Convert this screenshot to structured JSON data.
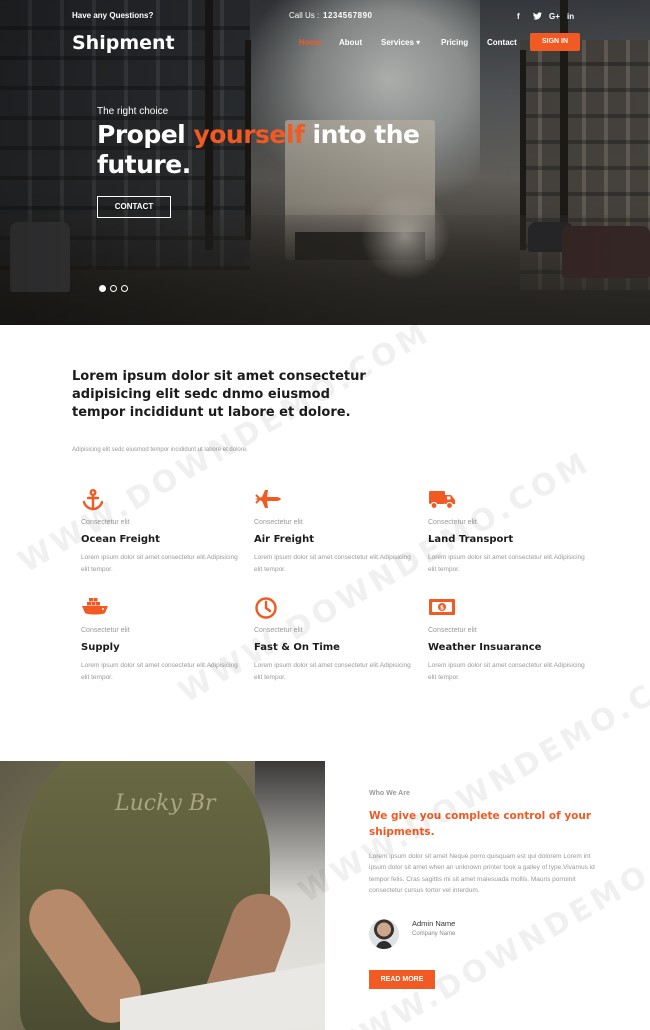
{
  "topbar": {
    "question": "Have any Questions?",
    "call_label": "Call Us :",
    "call_number": "1234567890",
    "social": [
      "f",
      "t",
      "G+",
      "in"
    ]
  },
  "brand": {
    "logo": "Shipment"
  },
  "nav": {
    "items": [
      "Home",
      "About",
      "Services ▾",
      "Pricing",
      "Contact"
    ],
    "active": "Home",
    "signin": "SIGN IN"
  },
  "hero": {
    "kicker": "The right choice",
    "title_pre": "Propel ",
    "title_highlight": "yourself",
    "title_post": " into the future.",
    "button": "CONTACT",
    "slides": 3,
    "active_slide": 1
  },
  "intro": {
    "title": "Lorem ipsum dolor sit amet consectetur adipisicing elit sedc dnmo eiusmod tempor incididunt ut labore et dolore.",
    "subtitle": "Adipisicing elit sedc eiusmod tempor incididunt ut labore et dolore."
  },
  "services": [
    {
      "icon": "anchor-icon",
      "kicker": "Consectetur elit",
      "name": "Ocean Freight",
      "desc": "Lorem ipsum dolor sit amet consectetur elit.Adipisicing elit tempor."
    },
    {
      "icon": "airplane-icon",
      "kicker": "Consectetur elit",
      "name": "Air Freight",
      "desc": "Lorem ipsum dolor sit amet consectetur elit.Adipisicing elit tempor."
    },
    {
      "icon": "truck-icon",
      "kicker": "Consectetur elit",
      "name": "Land Transport",
      "desc": "Lorem ipsum dolor sit amet consectetur elit.Adipisicing elit tempor."
    },
    {
      "icon": "ship-icon",
      "kicker": "Consectetur elit",
      "name": "Supply",
      "desc": "Lorem ipsum dolor sit amet consectetur elit.Adipisicing elit tempor."
    },
    {
      "icon": "clock-icon",
      "kicker": "Consectetur elit",
      "name": "Fast & On Time",
      "desc": "Lorem ipsum dolor sit amet consectetur elit.Adipisicing elit tempor."
    },
    {
      "icon": "money-icon",
      "kicker": "Consectetur elit",
      "name": "Weather Insuarance",
      "desc": "Lorem ipsum dolor sit amet consectetur elit.Adipisicing elit tempor."
    }
  ],
  "about": {
    "kicker": "Who We Are",
    "title": "We give you complete control of your shipments.",
    "desc": "Lorem ipsum dolor sit amet Neque porro quisquam est qui dolorem Lorem int ipsum dolor sit amet when an unknown printer took a galley of type.Vivamus id tempor felis. Cras sagittis mi sit amet malesuada mollis. Mauris porroinit consectetur cursus tortor vel interdum.",
    "author_name": "Admin Name",
    "author_role": "Company Name",
    "button": "READ MORE",
    "image_text": "Lucky Br"
  },
  "watermark": "WWW.DOWNDEMO.COM",
  "colors": {
    "accent": "#f15a22",
    "dark": "#1b1b1b",
    "muted": "#999999"
  }
}
